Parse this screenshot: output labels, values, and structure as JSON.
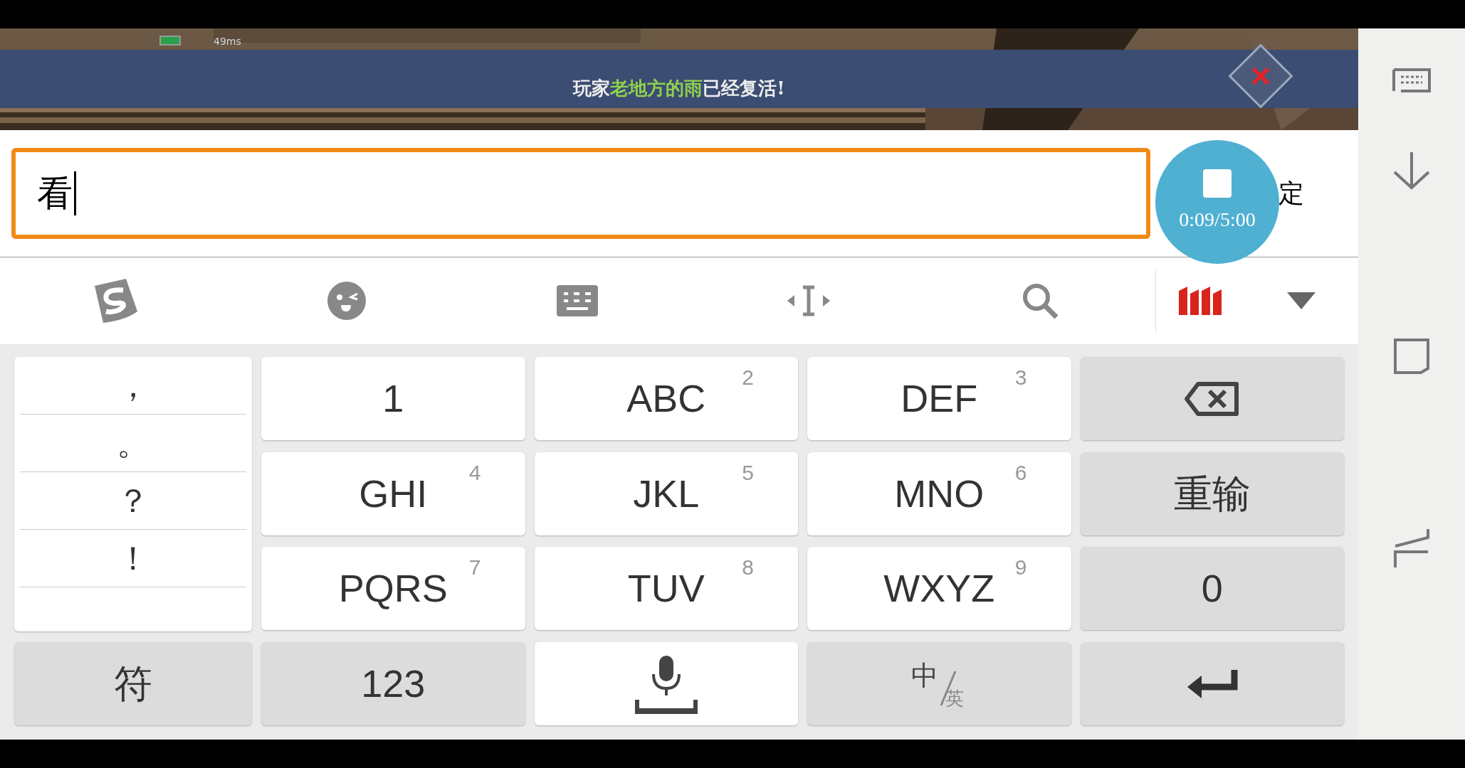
{
  "game": {
    "ping": "49ms",
    "notice": [
      {
        "text": "玩家",
        "highlight": false
      },
      {
        "text": "老地方的雨",
        "highlight": true
      },
      {
        "text": "已经复活!",
        "highlight": false
      }
    ]
  },
  "input": {
    "value": "看"
  },
  "confirm": "定",
  "recorder": {
    "time": "0:09/5:00"
  },
  "punctuation": [
    "，",
    "。",
    "？",
    "！"
  ],
  "keys": [
    {
      "kind": "letter",
      "label": "1"
    },
    {
      "kind": "letter",
      "label": "ABC",
      "number": "2"
    },
    {
      "kind": "letter",
      "label": "DEF",
      "number": "3"
    },
    {
      "kind": "backspace"
    },
    {
      "kind": "letter",
      "label": "GHI",
      "number": "4"
    },
    {
      "kind": "letter",
      "label": "JKL",
      "number": "5"
    },
    {
      "kind": "letter",
      "label": "MNO",
      "number": "6"
    },
    {
      "kind": "function",
      "label": "重输"
    },
    {
      "kind": "letter",
      "label": "PQRS",
      "number": "7"
    },
    {
      "kind": "letter",
      "label": "TUV",
      "number": "8"
    },
    {
      "kind": "letter",
      "label": "WXYZ",
      "number": "9"
    },
    {
      "kind": "function",
      "label": "0"
    }
  ],
  "bottom_row": [
    {
      "kind": "function",
      "label": "符"
    },
    {
      "kind": "function",
      "label": "123"
    },
    {
      "kind": "space"
    },
    {
      "kind": "language",
      "main": "中",
      "sub": "英"
    },
    {
      "kind": "enter"
    }
  ]
}
